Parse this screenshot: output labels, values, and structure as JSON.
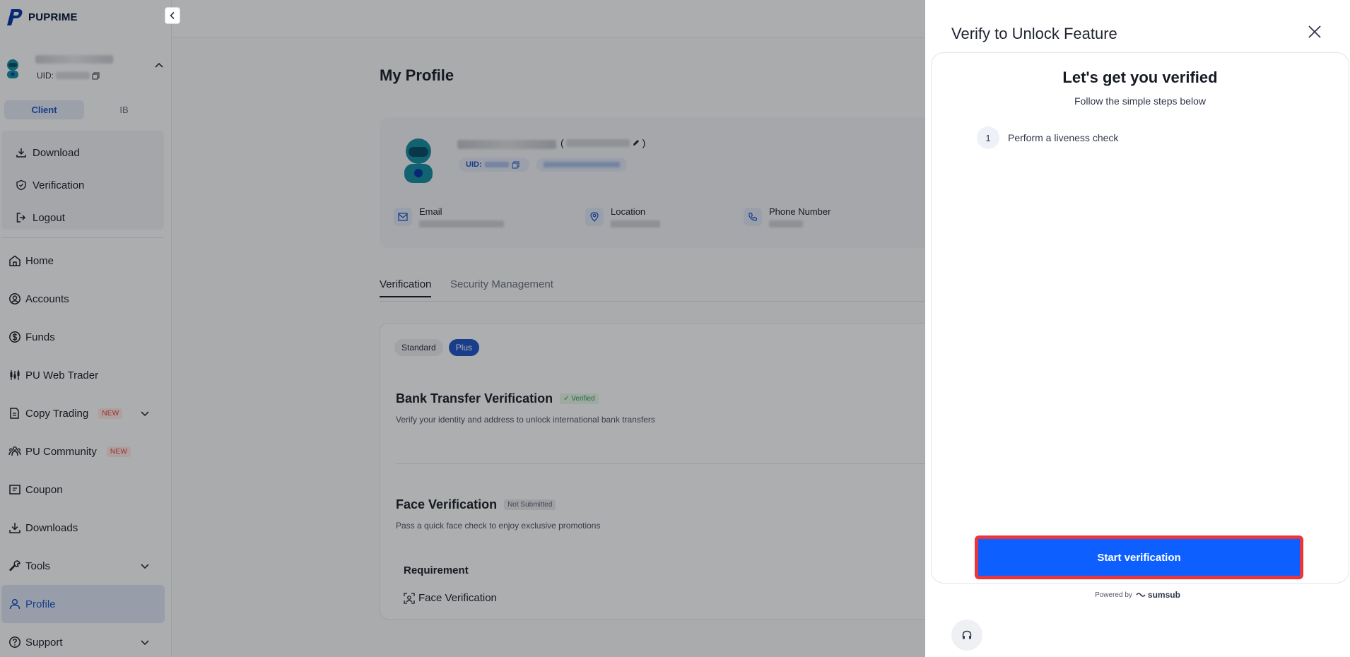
{
  "brand": {
    "name": "PUPRIME",
    "accent": "#2358c7"
  },
  "user": {
    "uid_label": "UID:"
  },
  "role_tabs": [
    {
      "label": "Client",
      "active": true
    },
    {
      "label": "IB",
      "active": false
    }
  ],
  "quick_menu": [
    {
      "label": "Download",
      "icon": "download-icon"
    },
    {
      "label": "Verification",
      "icon": "shield-check-icon"
    },
    {
      "label": "Logout",
      "icon": "logout-icon"
    }
  ],
  "nav": [
    {
      "label": "Home",
      "icon": "home-icon"
    },
    {
      "label": "Accounts",
      "icon": "user-circle-icon"
    },
    {
      "label": "Funds",
      "icon": "dollar-icon"
    },
    {
      "label": "PU Web Trader",
      "icon": "candlestick-icon"
    },
    {
      "label": "Copy Trading",
      "icon": "copy-icon",
      "badge": "NEW",
      "expand": true
    },
    {
      "label": "PU Community",
      "icon": "community-icon",
      "badge": "NEW"
    },
    {
      "label": "Coupon",
      "icon": "coupon-icon"
    },
    {
      "label": "Downloads",
      "icon": "download-icon"
    },
    {
      "label": "Tools",
      "icon": "wrench-icon",
      "expand": true
    },
    {
      "label": "Profile",
      "icon": "user-icon",
      "active": true
    },
    {
      "label": "Support",
      "icon": "help-icon",
      "expand": true
    }
  ],
  "main": {
    "title": "My Profile",
    "profile": {
      "uid_label": "UID:",
      "fields": [
        {
          "label": "Email",
          "icon": "mail-icon"
        },
        {
          "label": "Location",
          "icon": "location-icon"
        },
        {
          "label": "Phone Number",
          "icon": "phone-icon"
        }
      ]
    },
    "tabs": [
      {
        "label": "Verification",
        "active": true
      },
      {
        "label": "Security Management",
        "active": false
      }
    ],
    "level_tabs": [
      {
        "label": "Standard",
        "active": false
      },
      {
        "label": "Plus",
        "active": true
      }
    ],
    "bank": {
      "title": "Bank Transfer Verification",
      "badge": "Verified",
      "desc": "Verify your identity and address to unlock international bank transfers"
    },
    "face": {
      "title": "Face Verification",
      "badge": "Not Submitted",
      "desc": "Pass a quick face check to enjoy exclusive promotions"
    },
    "requirement": {
      "title": "Requirement",
      "item": "Face Verification"
    }
  },
  "drawer": {
    "title": "Verify to Unlock Feature",
    "frame_title": "Let's get you verified",
    "frame_subtitle": "Follow the simple steps below",
    "steps": [
      {
        "num": "1",
        "label": "Perform a liveness check"
      }
    ],
    "start_button": "Start verification",
    "powered_by": "Powered by",
    "provider": "sumsub"
  }
}
